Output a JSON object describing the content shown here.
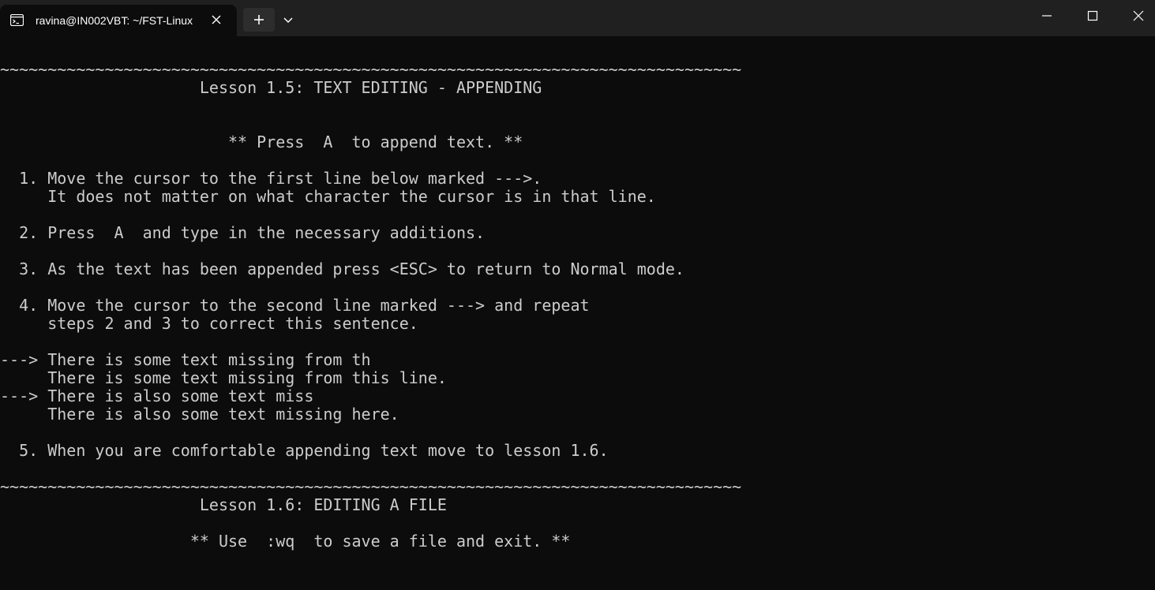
{
  "window": {
    "tab_title": "ravina@IN002VBT: ~/FST-Linux",
    "icons": {
      "tab": "terminal-icon",
      "close": "close-icon",
      "new_tab": "plus-icon",
      "dropdown": "chevron-down-icon",
      "minimize": "minimize-icon",
      "maximize": "maximize-icon",
      "window_close": "close-icon"
    }
  },
  "terminal": {
    "colors": {
      "background": "#0c0c0c",
      "foreground": "#cccccc",
      "titlebar": "#202020"
    },
    "lines": [
      "~~~~~~~~~~~~~~~~~~~~~~~~~~~~~~~~~~~~~~~~~~~~~~~~~~~~~~~~~~~~~~~~~~~~~~~~~~~~~~",
      "                     Lesson 1.5: TEXT EDITING - APPENDING",
      "",
      "",
      "                        ** Press  A  to append text. **",
      "",
      "  1. Move the cursor to the first line below marked --->.",
      "     It does not matter on what character the cursor is in that line.",
      "",
      "  2. Press  A  and type in the necessary additions.",
      "",
      "  3. As the text has been appended press <ESC> to return to Normal mode.",
      "",
      "  4. Move the cursor to the second line marked ---> and repeat",
      "     steps 2 and 3 to correct this sentence.",
      "",
      "---> There is some text missing from th",
      "     There is some text missing from this line.",
      "---> There is also some text miss",
      "     There is also some text missing here.",
      "",
      "  5. When you are comfortable appending text move to lesson 1.6.",
      "",
      "~~~~~~~~~~~~~~~~~~~~~~~~~~~~~~~~~~~~~~~~~~~~~~~~~~~~~~~~~~~~~~~~~~~~~~~~~~~~~~",
      "                     Lesson 1.6: EDITING A FILE",
      "",
      "                    ** Use  :wq  to save a file and exit. **"
    ]
  }
}
